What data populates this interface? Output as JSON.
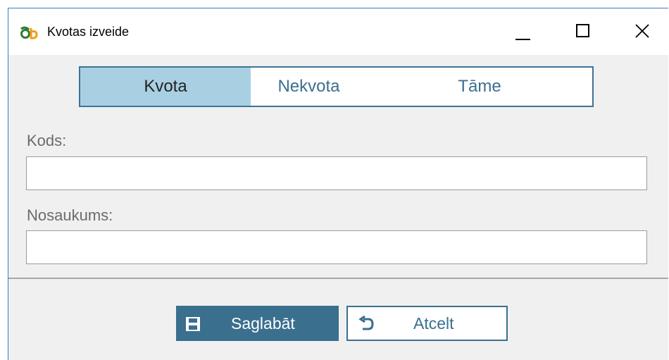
{
  "window": {
    "title": "Kvotas izveide",
    "logo_text": "ab"
  },
  "tabs": [
    {
      "label": "Kvota",
      "active": true
    },
    {
      "label": "Nekvota",
      "active": false
    },
    {
      "label": "Tāme",
      "active": false
    }
  ],
  "form": {
    "code_label": "Kods:",
    "code_value": "",
    "name_label": "Nosaukums:",
    "name_value": ""
  },
  "actions": {
    "save_label": "Saglabāt",
    "cancel_label": "Atcelt"
  },
  "colors": {
    "accent": "#3a6f8e",
    "active_tab": "#a9d0e2",
    "window_border": "#3c7fbf"
  },
  "icons": {
    "save": "floppy-disk-icon",
    "cancel": "undo-arrow-icon"
  }
}
